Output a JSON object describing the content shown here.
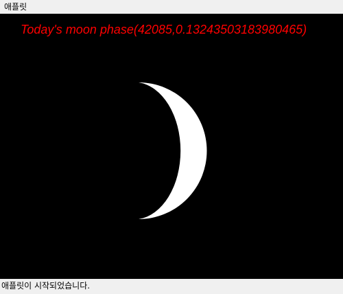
{
  "menubar": {
    "item_label": "애플릿"
  },
  "applet": {
    "title": "Today's moon phase(42085,0.13243503183980465)",
    "title_color": "#ff0000",
    "background_color": "#000000",
    "moon_color": "#ffffff",
    "moon_phase": 0.13243503183980465
  },
  "statusbar": {
    "text": "애플릿이 시작되었습니다."
  }
}
